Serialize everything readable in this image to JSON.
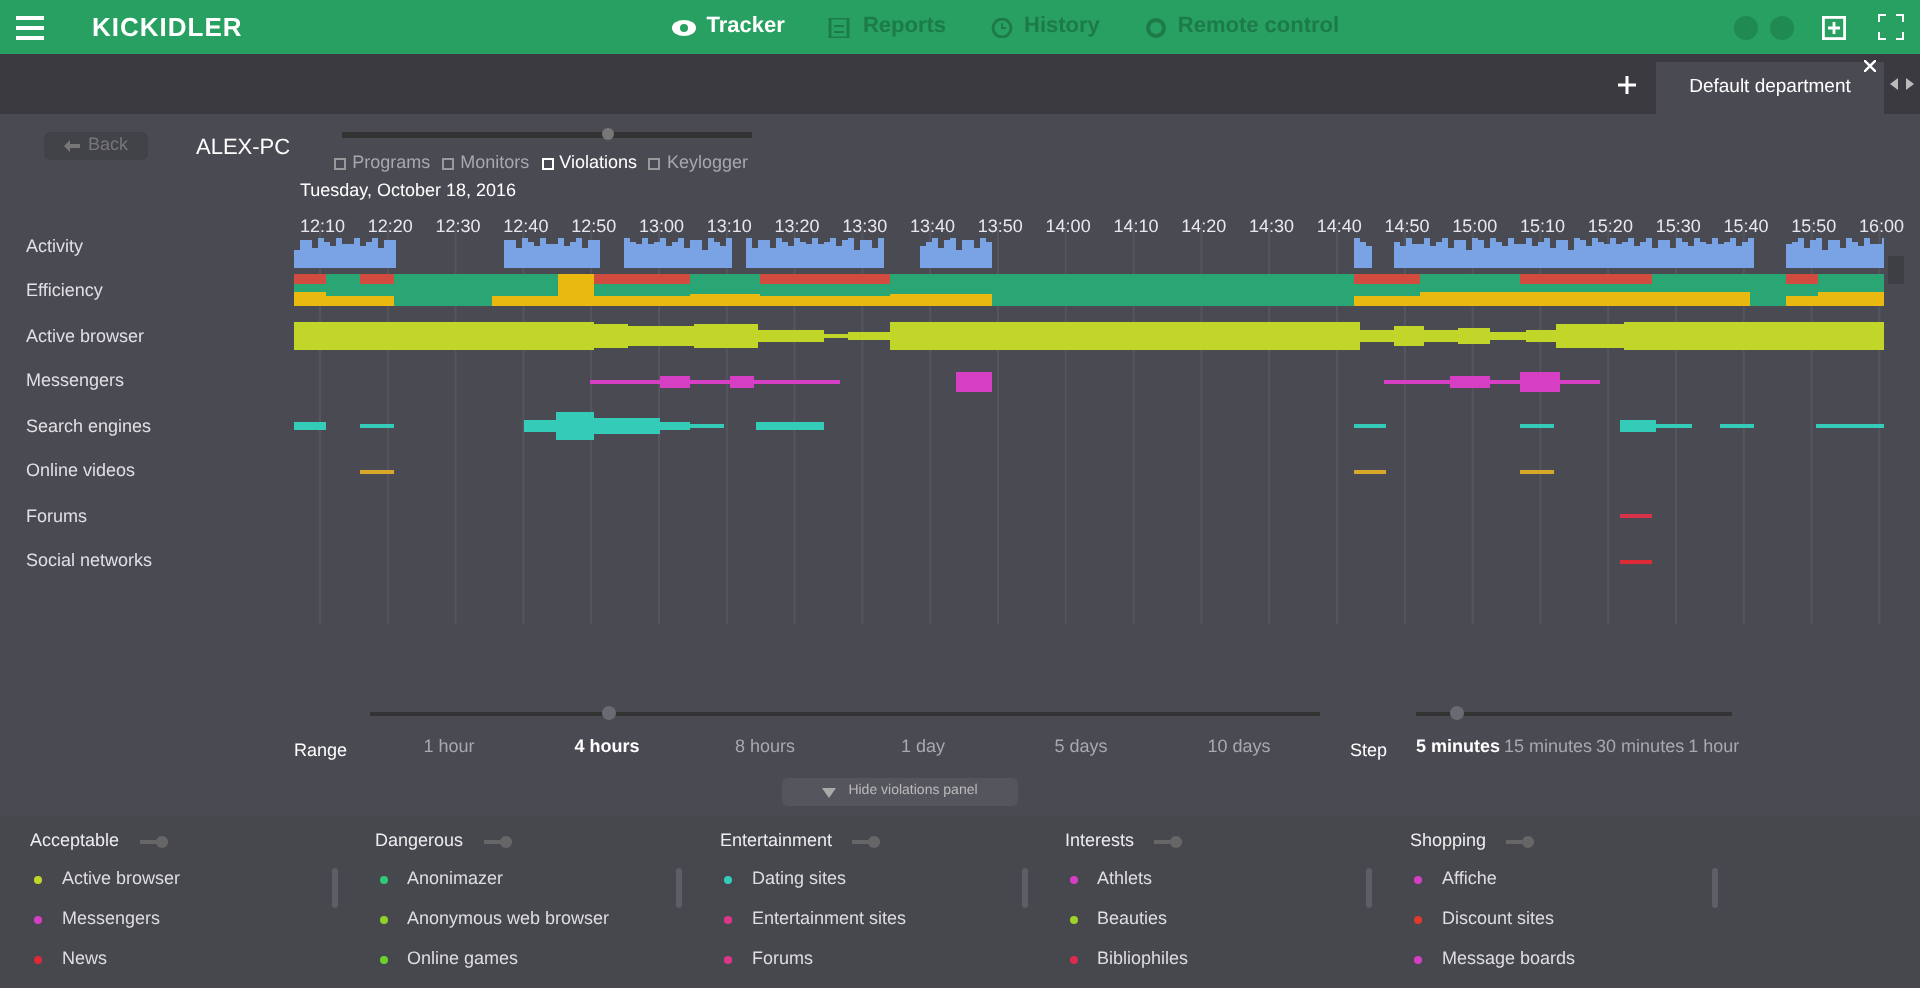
{
  "header": {
    "logo": "KICKIDLER",
    "nav": [
      {
        "label": "Tracker",
        "selected": true,
        "kind": "eye"
      },
      {
        "label": "Reports",
        "selected": false,
        "kind": "doc"
      },
      {
        "label": "History",
        "selected": false,
        "kind": "clock"
      },
      {
        "label": "Remote control",
        "selected": false,
        "kind": "ring"
      }
    ]
  },
  "tabs": [
    {
      "label": "Default department",
      "selected": true
    }
  ],
  "back_button": "Back",
  "computer": "ALEX-PC",
  "views": [
    {
      "label": "Programs",
      "selected": false
    },
    {
      "label": "Monitors",
      "selected": false
    },
    {
      "label": "Violations",
      "selected": true
    },
    {
      "label": "Keylogger",
      "selected": false
    }
  ],
  "date": "Tuesday, October 18, 2016",
  "times": [
    "12:10",
    "12:20",
    "12:30",
    "12:40",
    "12:50",
    "13:00",
    "13:10",
    "13:20",
    "13:30",
    "13:40",
    "13:50",
    "14:00",
    "14:10",
    "14:20",
    "14:30",
    "14:40",
    "14:50",
    "15:00",
    "15:10",
    "15:20",
    "15:30",
    "15:40",
    "15:50",
    "16:00"
  ],
  "rows": [
    {
      "label": "Activity",
      "kind": "activity"
    },
    {
      "label": "Efficiency",
      "kind": "efficiency"
    },
    {
      "label": "Active browser",
      "kind": "band",
      "color": "#c2d62a"
    },
    {
      "label": "Messengers",
      "kind": "band",
      "color": "#d63fc4"
    },
    {
      "label": "Search engines",
      "kind": "band",
      "color": "#35cbb9"
    },
    {
      "label": "Online videos",
      "kind": "band",
      "color": "#d9a82b"
    },
    {
      "label": "Forums",
      "kind": "band",
      "color": "#d9334a"
    },
    {
      "label": "Social networks",
      "kind": "band",
      "color": "#dd2a36"
    }
  ],
  "range": {
    "label": "Range",
    "options": [
      {
        "label": "1 hour",
        "selected": false
      },
      {
        "label": "4 hours",
        "selected": true
      },
      {
        "label": "8 hours",
        "selected": false
      },
      {
        "label": "1 day",
        "selected": false
      },
      {
        "label": "5 days",
        "selected": false
      },
      {
        "label": "10 days",
        "selected": false
      }
    ]
  },
  "step": {
    "label": "Step",
    "options": [
      {
        "label": "5 minutes",
        "selected": true
      },
      {
        "label": "15 minutes",
        "selected": false
      },
      {
        "label": "30 minutes",
        "selected": false
      },
      {
        "label": "1 hour",
        "selected": false
      }
    ]
  },
  "hide_panel_button": "Hide violations panel",
  "categories": [
    {
      "name": "Acceptable",
      "items": [
        {
          "label": "Active browser",
          "color": "#c2d62a"
        },
        {
          "label": "Messengers",
          "color": "#d63fc4"
        },
        {
          "label": "News",
          "color": "#dd2a36"
        }
      ]
    },
    {
      "name": "Dangerous",
      "items": [
        {
          "label": "Anonimazer",
          "color": "#2fcb7a"
        },
        {
          "label": "Anonymous web browser",
          "color": "#8fd12a"
        },
        {
          "label": "Online games",
          "color": "#6fcf2a"
        }
      ]
    },
    {
      "name": "Entertainment",
      "items": [
        {
          "label": "Dating sites",
          "color": "#35cbb9"
        },
        {
          "label": "Entertainment sites",
          "color": "#e0358a"
        },
        {
          "label": "Forums",
          "color": "#e0358a"
        }
      ]
    },
    {
      "name": "Interests",
      "items": [
        {
          "label": "Athlets",
          "color": "#d63fc4"
        },
        {
          "label": "Beauties",
          "color": "#9ed32a"
        },
        {
          "label": "Bibliophiles",
          "color": "#dd2a50"
        }
      ]
    },
    {
      "name": "Shopping",
      "items": [
        {
          "label": "Affiche",
          "color": "#d63fc4"
        },
        {
          "label": "Discount sites",
          "color": "#dd3a2a"
        },
        {
          "label": "Message boards",
          "color": "#d63fc4"
        }
      ]
    }
  ]
}
